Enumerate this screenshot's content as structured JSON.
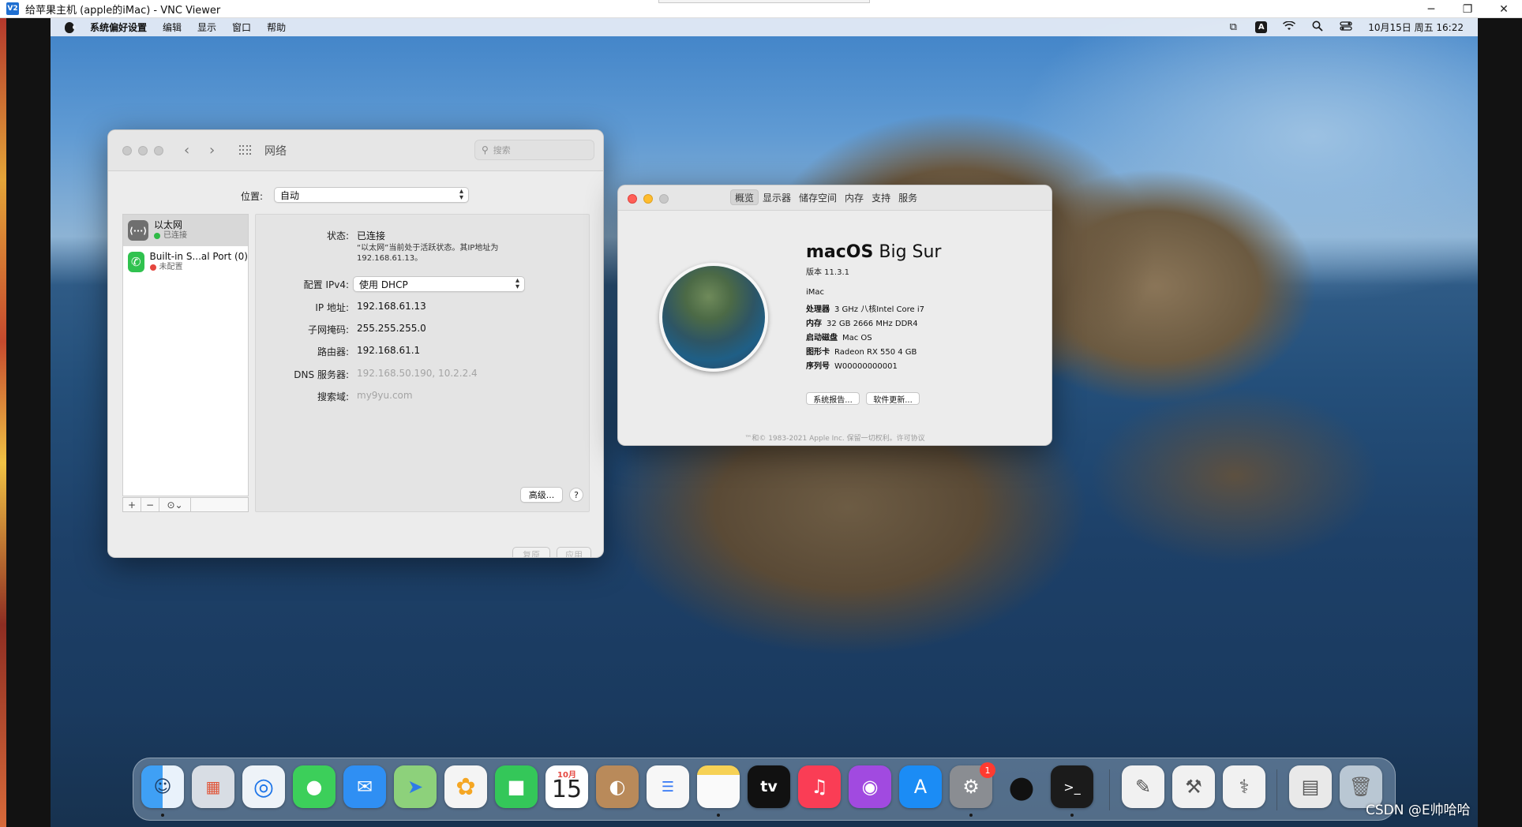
{
  "vnc": {
    "title": "给苹果主机 (apple的iMac) - VNC Viewer",
    "logo": "V2",
    "minimize_glyph": "─",
    "restore_glyph": "❐",
    "close_glyph": "✕"
  },
  "menubar": {
    "app_name": "系统偏好设置",
    "items": [
      "编辑",
      "显示",
      "窗口",
      "帮助"
    ],
    "input_source": "A",
    "clock": "10月15日 周五 16:22"
  },
  "network": {
    "title": "网络",
    "search_placeholder": "搜索",
    "location_label": "位置:",
    "location_value": "自动",
    "services": [
      {
        "name": "以太网",
        "status": "已连接",
        "icon": "⟨···⟩"
      },
      {
        "name": "Built-in S...al Port (0)",
        "status": "未配置",
        "icon": "✆"
      }
    ],
    "status_label": "状态:",
    "status_value": "已连接",
    "status_note": "“以太网”当前处于活跃状态。其IP地址为192.168.61.13。",
    "ipv4_label": "配置 IPv4:",
    "ipv4_value": "使用 DHCP",
    "ip_label": "IP 地址:",
    "ip_value": "192.168.61.13",
    "mask_label": "子网掩码:",
    "mask_value": "255.255.255.0",
    "router_label": "路由器:",
    "router_value": "192.168.61.1",
    "dns_label": "DNS 服务器:",
    "dns_value": "192.168.50.190, 10.2.2.4",
    "domain_label": "搜索域:",
    "domain_value": "my9yu.com",
    "advanced_button": "高级...",
    "help_button": "?",
    "revert_button": "复原",
    "apply_button": "应用",
    "add_glyph": "+",
    "remove_glyph": "−",
    "gear_glyph": "⊙⌄"
  },
  "about": {
    "tabs": [
      "概览",
      "显示器",
      "储存空间",
      "内存",
      "支持",
      "服务"
    ],
    "os_name_bold": "macOS",
    "os_name_light": "Big Sur",
    "version": "版本 11.3.1",
    "model": "iMac",
    "specs": [
      {
        "k": "处理器",
        "v": "3 GHz 八核Intel Core i7"
      },
      {
        "k": "内存",
        "v": "32 GB 2666 MHz DDR4"
      },
      {
        "k": "启动磁盘",
        "v": "Mac OS"
      },
      {
        "k": "图形卡",
        "v": "Radeon RX 550 4 GB"
      },
      {
        "k": "序列号",
        "v": "W00000000001"
      }
    ],
    "report_button": "系统报告...",
    "update_button": "软件更新...",
    "footer": "™和© 1983-2021 Apple Inc. 保留一切权利。许可协议"
  },
  "dock": {
    "calendar_month": "10月",
    "calendar_day": "15",
    "settings_badge": "1",
    "apple_tv_label": "tv"
  },
  "watermark": "CSDN @E帅哈哈"
}
